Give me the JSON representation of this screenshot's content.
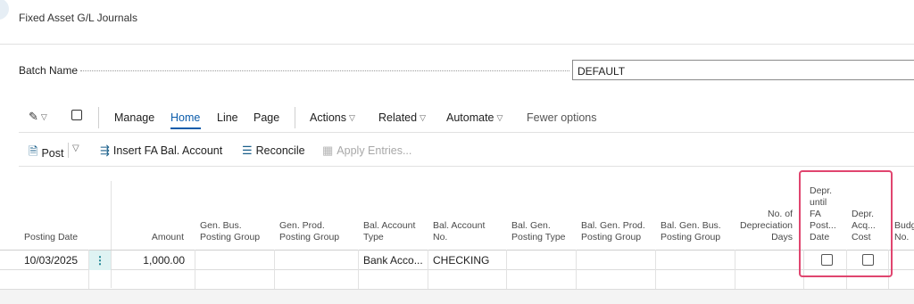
{
  "page": {
    "title": "Fixed Asset G/L Journals"
  },
  "batch": {
    "label": "Batch Name",
    "value": "DEFAULT"
  },
  "menu": {
    "items": [
      "Manage",
      "Home",
      "Line",
      "Page"
    ],
    "dropdowns": [
      "Actions",
      "Related",
      "Automate"
    ],
    "fewer_options": "Fewer options"
  },
  "actions": {
    "post": "Post",
    "insert_fa_bal_account": "Insert FA Bal. Account",
    "reconcile": "Reconcile",
    "apply_entries": "Apply Entries..."
  },
  "table": {
    "headers": {
      "posting_date": "Posting Date",
      "amount": "Amount",
      "gen_bus_posting_group": [
        "Gen. Bus.",
        "Posting Group"
      ],
      "gen_prod_posting_group": [
        "Gen. Prod.",
        "Posting Group"
      ],
      "bal_account_type": [
        "Bal. Account",
        "Type"
      ],
      "bal_account_no": [
        "Bal. Account",
        "No."
      ],
      "bal_gen_posting_type": [
        "Bal. Gen.",
        "Posting Type"
      ],
      "bal_gen_prod_posting_group": [
        "Bal. Gen. Prod.",
        "Posting Group"
      ],
      "bal_gen_bus_posting_group": [
        "Bal. Gen. Bus.",
        "Posting Group"
      ],
      "no_of_depreciation_days": [
        "No. of",
        "Depreciation",
        "Days"
      ],
      "depr_until_fa_posting_date": [
        "Depr.",
        "until",
        "FA",
        "Post...",
        "Date"
      ],
      "depr_acq_cost": [
        "Depr.",
        "Acq...",
        "Cost"
      ],
      "budget_no": [
        "Budg",
        "No."
      ]
    },
    "row": {
      "posting_date": "10/03/2025",
      "row_menu": "⋮",
      "amount": "1,000.00",
      "bal_account_type": "Bank Acco...",
      "bal_account_no": "CHECKING",
      "depr_until_fa_posting_date_checked": false,
      "depr_acq_cost_checked": false
    }
  },
  "colors": {
    "accent": "#0b5cab",
    "highlight": "#e0456f"
  }
}
